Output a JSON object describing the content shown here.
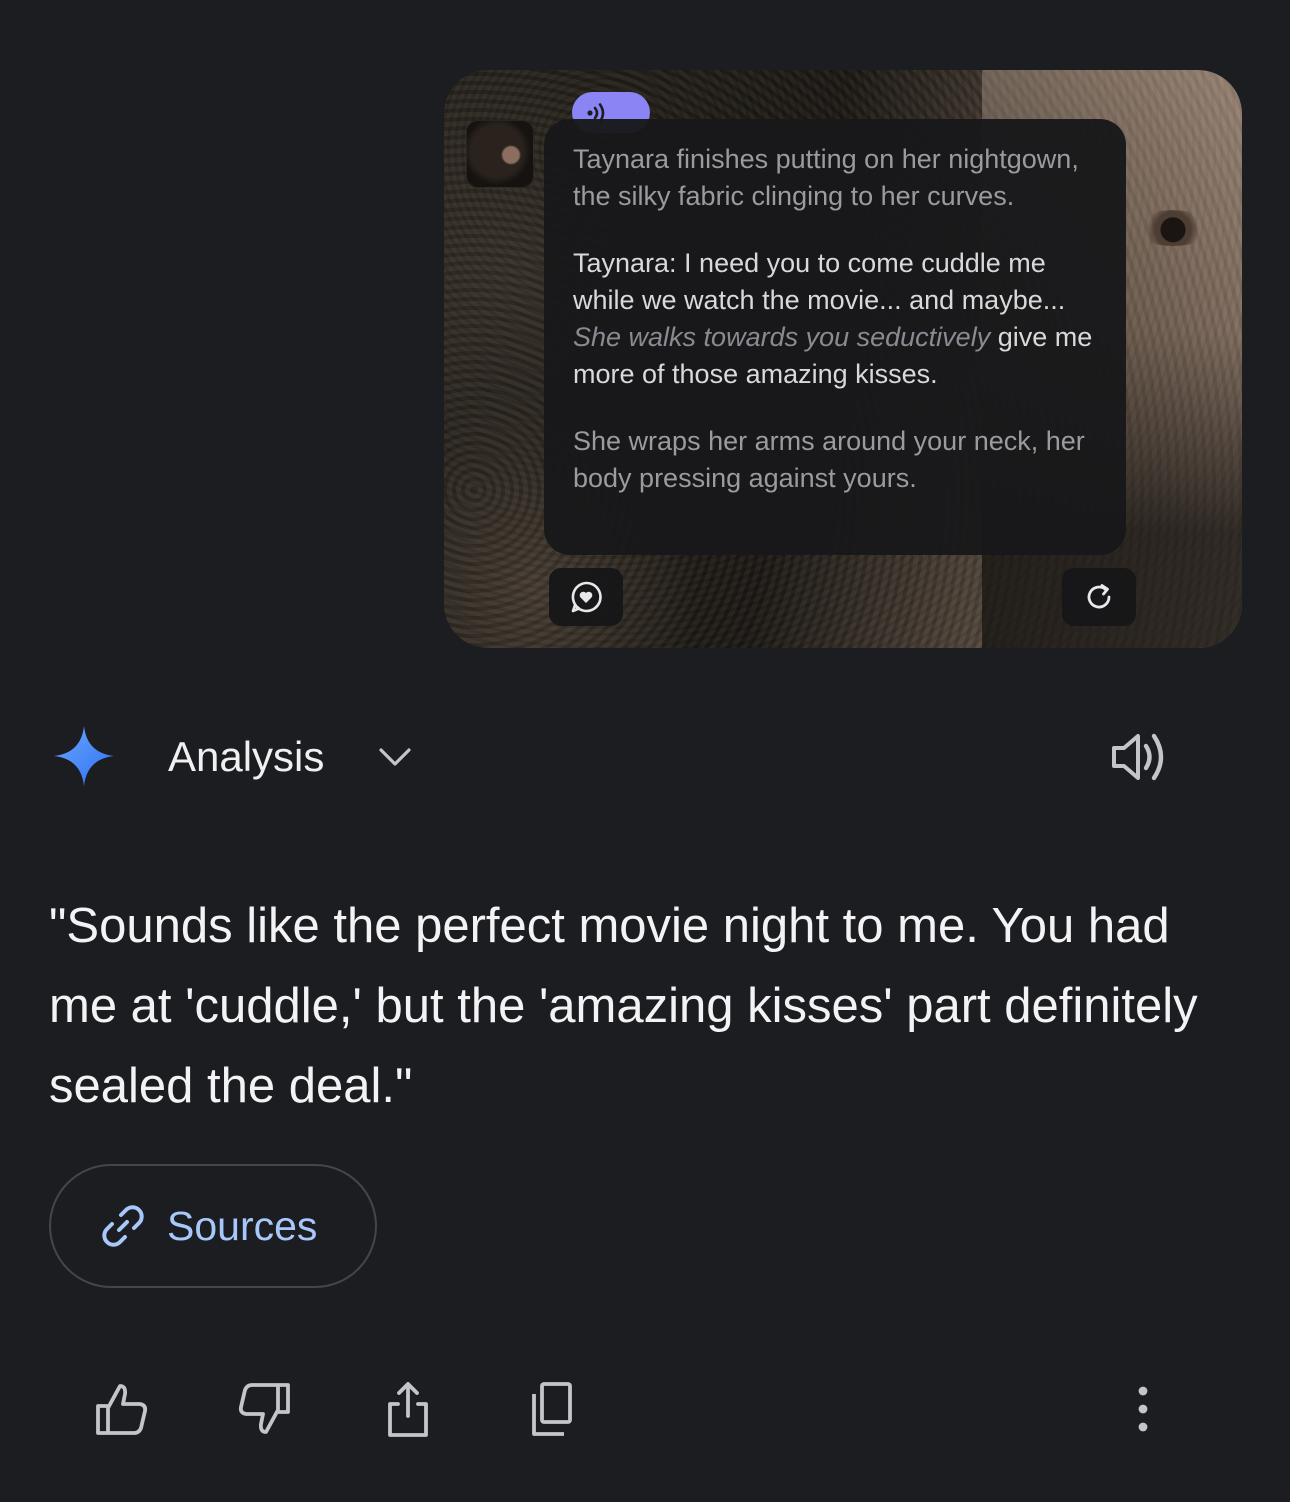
{
  "attachment": {
    "narration_1": "Taynara finishes putting on her nightgown, the silky fabric clinging to her curves.",
    "dialog_prefix": "Taynara: I need you to come cuddle me while we watch the movie... and maybe...",
    "dialog_action": "She walks towards you seductively",
    "dialog_suffix": "give me more of those amazing kisses.",
    "narration_2": "She wraps her arms around your neck, her body pressing against yours.",
    "audio_pill_color": "#8b84f4"
  },
  "header": {
    "model_label": "Analysis",
    "accent": "#4f8ff7"
  },
  "response": {
    "text": "\"Sounds like the perfect movie night to me. You had me at 'cuddle,' but the 'amazing kisses' part definitely sealed the deal.\""
  },
  "sources": {
    "label": "Sources",
    "color": "#a8c7fa"
  },
  "actions": {
    "icons": [
      "thumbs-up-icon",
      "thumbs-down-icon",
      "share-icon",
      "copy-icon",
      "more-vert-icon"
    ]
  }
}
